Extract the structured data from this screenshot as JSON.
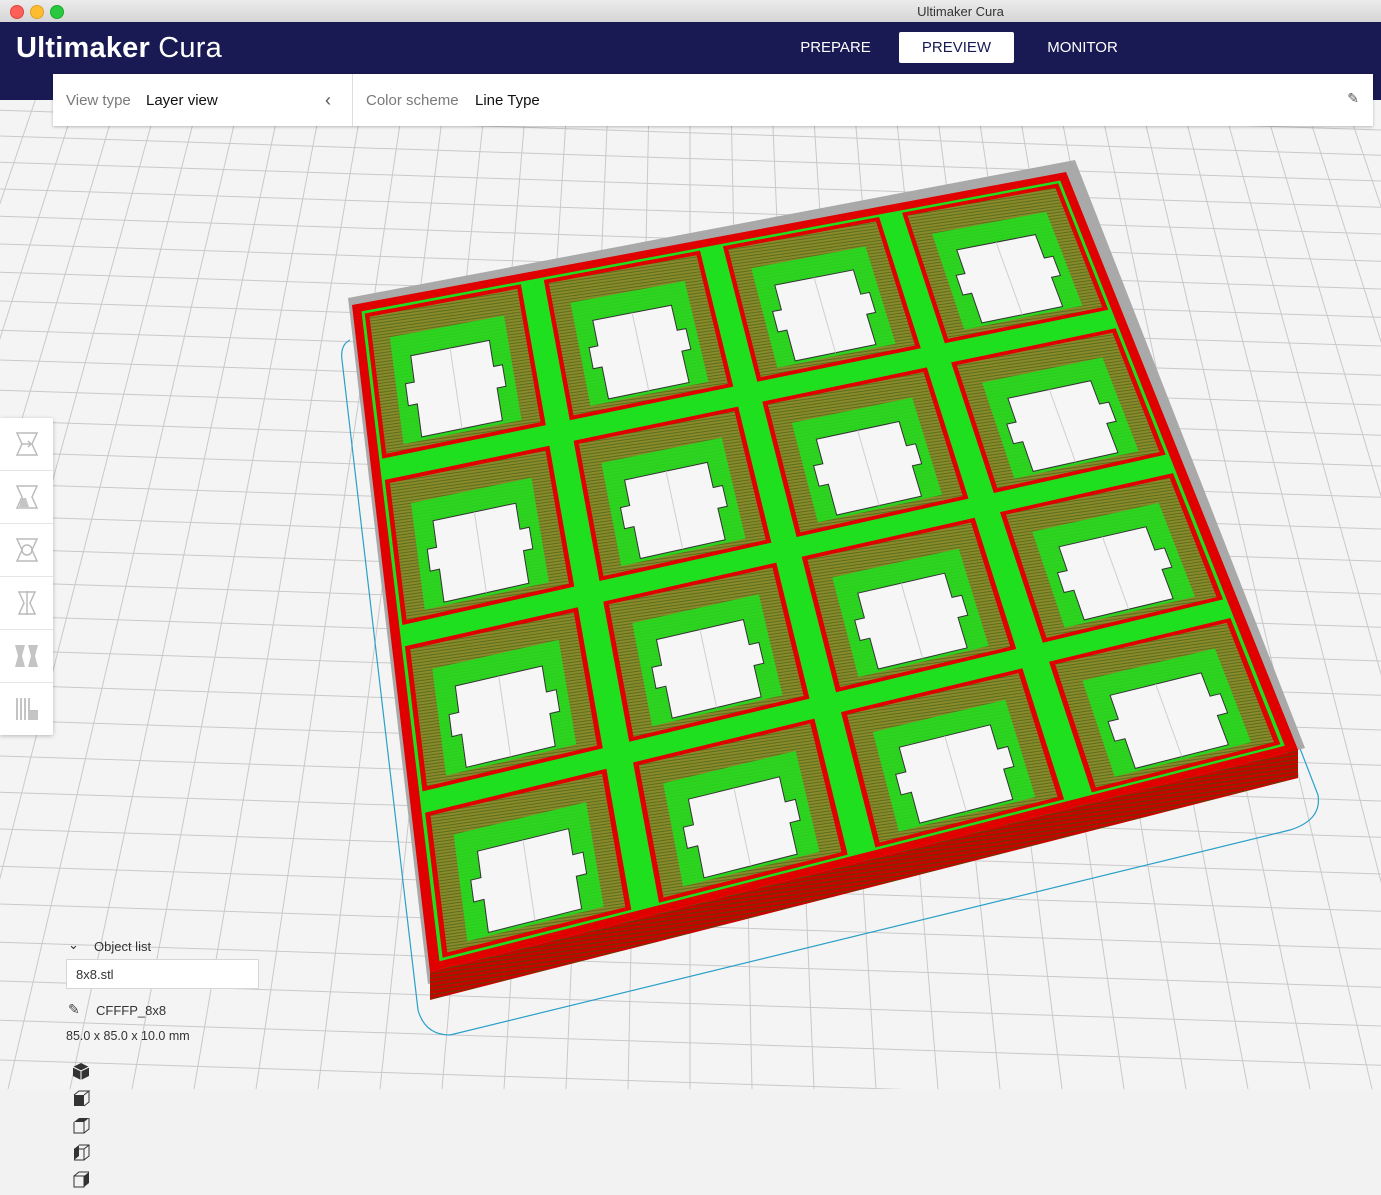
{
  "window": {
    "title": "Ultimaker Cura"
  },
  "header": {
    "logo_brand": "Ultimaker",
    "logo_product": "Cura",
    "tabs": [
      {
        "label": "PREPARE",
        "active": false
      },
      {
        "label": "PREVIEW",
        "active": true
      },
      {
        "label": "MONITOR",
        "active": false
      }
    ]
  },
  "viewbar": {
    "view_type_label": "View type",
    "view_type_value": "Layer view",
    "color_scheme_label": "Color scheme",
    "color_scheme_value": "Line Type"
  },
  "toolbar": {
    "tools": [
      "move-tool-icon",
      "scale-tool-icon",
      "rotate-tool-icon",
      "mirror-tool-icon",
      "per-model-settings-icon",
      "support-blocker-icon"
    ]
  },
  "object_list": {
    "title": "Object list",
    "file": "8x8.stl",
    "object_name": "CFFFP_8x8",
    "dimensions": "85.0 x 85.0 x 10.0 mm"
  },
  "camera_views": [
    "3d-view-icon",
    "front-view-icon",
    "top-view-icon",
    "left-view-icon",
    "right-view-icon"
  ],
  "colors": {
    "header_bg": "#191a53",
    "wall_outer": "#e00000",
    "wall_inner": "#1fe01f",
    "infill": "#9a9a32",
    "build_plate": "#f4f4f4",
    "grid_line": "#c9c9c9"
  }
}
